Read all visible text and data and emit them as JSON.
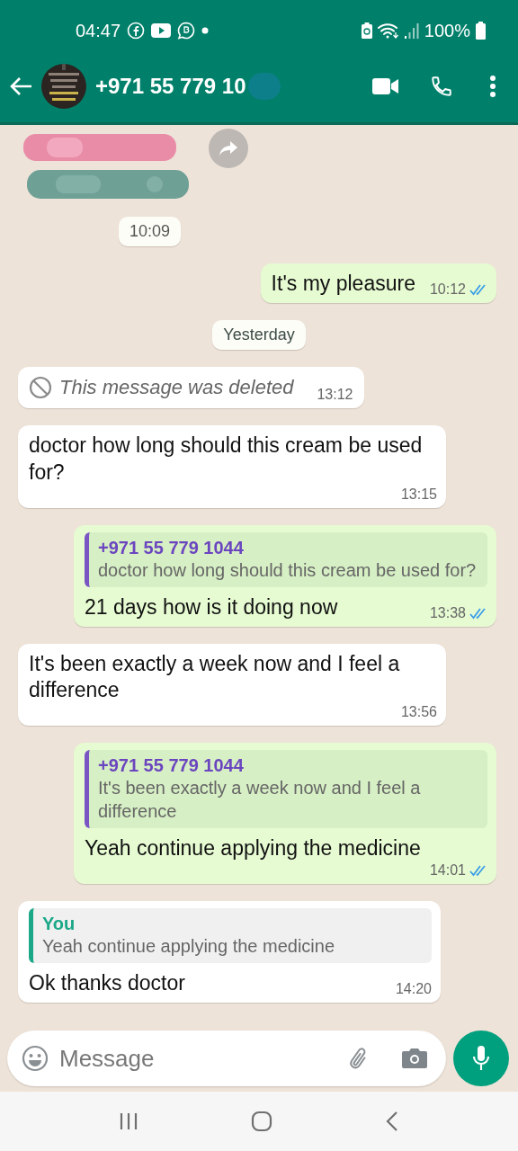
{
  "status_bar": {
    "time": "04:47",
    "battery": "100%"
  },
  "header": {
    "title": "+971 55 779 10",
    "redacted": true
  },
  "messages": [
    {
      "kind": "sticker",
      "time": "10:09"
    },
    {
      "kind": "outgoing",
      "text": "It's my pleasure",
      "time": "10:12",
      "read": true
    },
    {
      "kind": "date",
      "text": "Yesterday"
    },
    {
      "kind": "deleted",
      "text": "This message was deleted",
      "time": "13:12"
    },
    {
      "kind": "incoming",
      "text": "doctor how long should this cream be used for?",
      "time": "13:15"
    },
    {
      "kind": "outgoing",
      "quote": {
        "author": "+971 55 779 1044",
        "text": "doctor how long should this cream be used for?"
      },
      "text": "21 days how is it doing now",
      "time": "13:38",
      "read": true
    },
    {
      "kind": "incoming",
      "text": "It's been exactly a week now and I feel a difference",
      "time": "13:56"
    },
    {
      "kind": "outgoing",
      "quote": {
        "author": "+971 55 779 1044",
        "text": "It's been exactly a week now and I feel a difference"
      },
      "text": "Yeah continue applying the medicine",
      "time": "14:01",
      "read": true
    },
    {
      "kind": "incoming",
      "quote": {
        "author": "You",
        "text": "Yeah continue applying the medicine"
      },
      "text": "Ok thanks doctor",
      "time": "14:20"
    }
  ],
  "composer": {
    "placeholder": "Message"
  }
}
